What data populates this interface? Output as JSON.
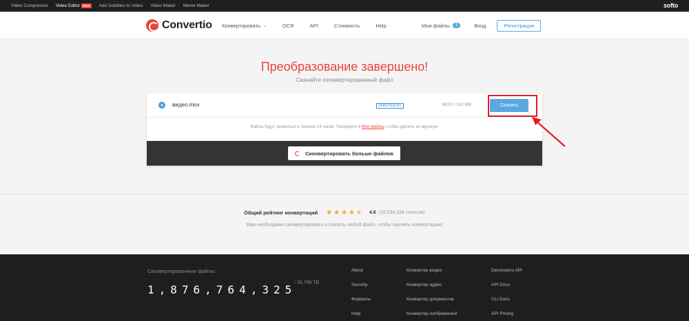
{
  "topbar": {
    "items": [
      {
        "label": "Video Compressor",
        "active": false
      },
      {
        "label": "Video Editor",
        "active": true,
        "badge": "NEW"
      },
      {
        "label": "Add Subtitles to Video",
        "active": false
      },
      {
        "label": "Video Maker",
        "active": false
      },
      {
        "label": "Meme Maker",
        "active": false
      }
    ],
    "brand": "softo"
  },
  "header": {
    "logo": "Convertio",
    "nav": [
      "Конвертировать",
      "OCR",
      "API",
      "Стоимость",
      "Help"
    ],
    "my_files": "Мои файлы",
    "my_files_count": "1",
    "login": "Вход",
    "register": "Регистрация"
  },
  "main": {
    "title": "Преобразование завершено!",
    "subtitle": "Скачайте сконвертированный файл",
    "file": {
      "name": "видео.mov",
      "status": "ЗАВЕРШЕНО",
      "size": "MOV / 110 MB",
      "download": "Скачать"
    },
    "note_before": "Файлы будут храниться в течение 24 часов. Перейдите в ",
    "note_link": "Мои файлы",
    "note_after": ", чтобы удалить их вручную.",
    "convert_more": "Сконвертировать больше файлов"
  },
  "rating": {
    "label": "Общий рейтинг конвертаций",
    "stars": 4.5,
    "value": "4.6",
    "votes": "(16,534,184 голосов)",
    "subtext": "Вам необходимо сконвертировать и скачать любой файл, чтобы оценить конвертацию!"
  },
  "footer": {
    "converted_label": "Сконвертированные файлы:",
    "counter": "1,876,764,325",
    "tb": "35,798 TB",
    "col1": [
      "About",
      "Security",
      "Форматы",
      "Help"
    ],
    "col2": [
      "Конвертер видео",
      "Конвертер аудио",
      "Конвертер документов",
      "Конвертер изображений"
    ],
    "col3": [
      "Developers API",
      "API Docs",
      "CLI Docs",
      "API Pricing"
    ]
  },
  "colors": {
    "accent": "#e9433a",
    "button": "#5aa8e0",
    "highlight": "#e51d1d"
  }
}
